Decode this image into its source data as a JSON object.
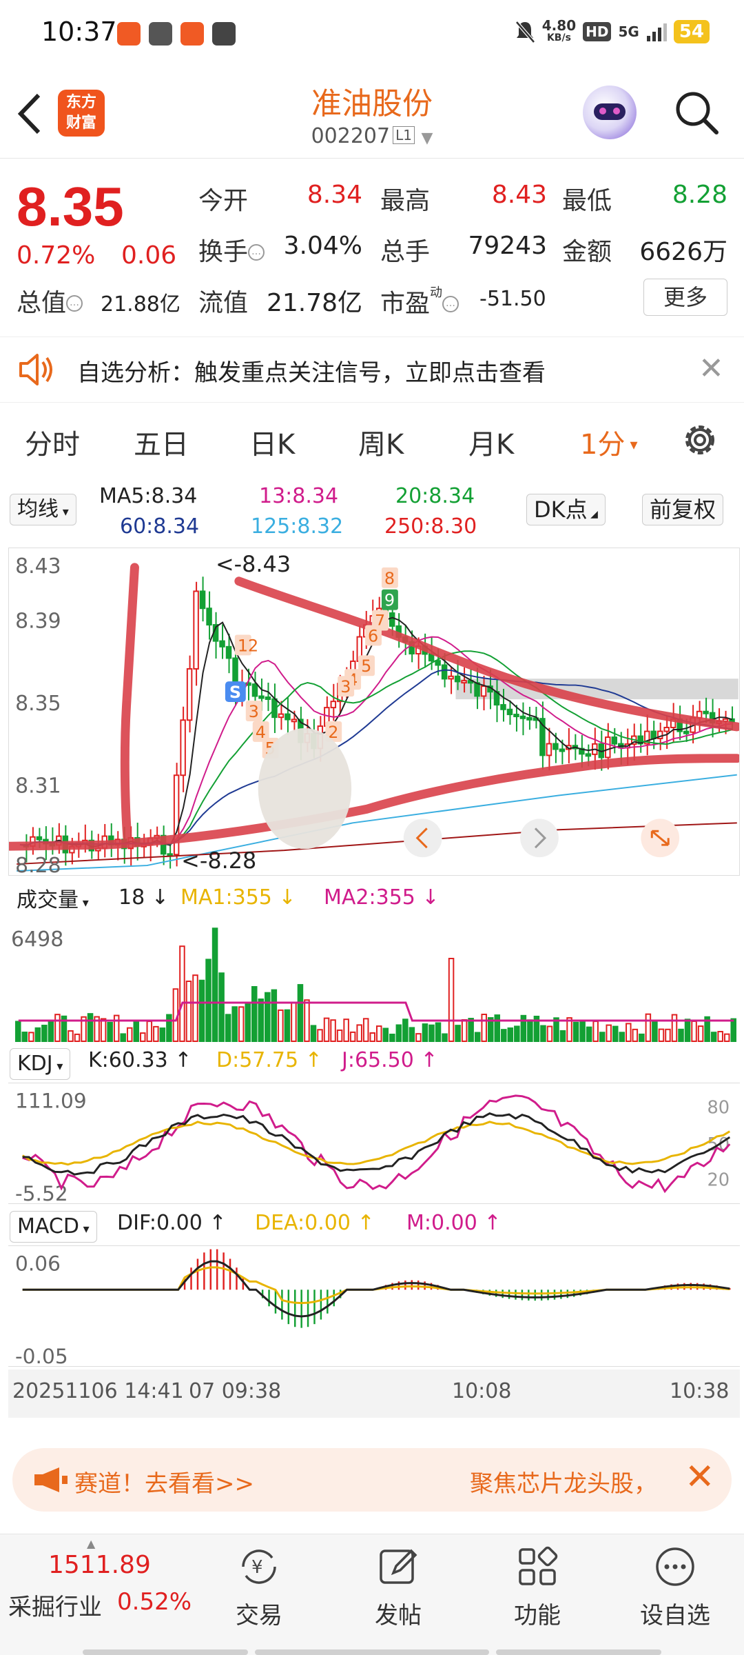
{
  "status_bar": {
    "time": "10:37",
    "net_speed": "4.80",
    "net_unit": "KB/s",
    "hd": "HD",
    "signal": "5G",
    "battery": "54"
  },
  "header": {
    "logo_line1": "东方",
    "logo_line2": "财富",
    "stock_name": "准油股份",
    "stock_code": "002207",
    "level_badge": "L1"
  },
  "quote": {
    "price": "8.35",
    "change_pct": "0.72%",
    "change": "0.06",
    "open_label": "今开",
    "open": "8.34",
    "high_label": "最高",
    "high": "8.43",
    "low_label": "最低",
    "low": "8.28",
    "turnover_label": "换手",
    "turnover": "3.04%",
    "volume_label": "总手",
    "volume": "79243",
    "amount_label": "金额",
    "amount": "6626万",
    "mktcap_label": "总值",
    "mktcap": "21.88亿",
    "float_label": "流值",
    "float_cap": "21.78亿",
    "pe_label": "市盈",
    "pe_sup": "动",
    "pe": "-51.50",
    "more_label": "更多"
  },
  "notice": {
    "text": "自选分析：触发重点关注信号，立即点击查看"
  },
  "tabs": [
    "分时",
    "五日",
    "日K",
    "周K",
    "月K",
    "1分"
  ],
  "chart": {
    "ma_selector": "均线",
    "ma5": "MA5:8.34",
    "ma13": "13:8.34",
    "ma20": "20:8.34",
    "ma60": "60:8.34",
    "ma125": "125:8.32",
    "ma250": "250:8.30",
    "dk_button": "DK点",
    "adjust_button": "前复权",
    "price_ticks": [
      "8.43",
      "8.39",
      "8.35",
      "8.31",
      "8.28"
    ],
    "high_marker": "<-8.43",
    "low_marker": "<-8.28",
    "td_labels": [
      "8",
      "9",
      "7",
      "6",
      "5",
      "4",
      "3",
      "12",
      "3",
      "4",
      "5",
      "2"
    ],
    "signal_s": "S",
    "vol_selector": "成交量",
    "vol_value": "18",
    "vol_ma1": "MA1:355",
    "vol_ma2": "MA2:355",
    "vol_tick": "6498",
    "kdj_selector": "KDJ",
    "kdj_k": "K:60.33",
    "kdj_d": "D:57.75",
    "kdj_j": "J:65.50",
    "kdj_ticks": [
      "111.09",
      "-5.52"
    ],
    "kdj_levels": [
      "80",
      "50",
      "20"
    ],
    "macd_selector": "MACD",
    "macd_dif": "DIF:0.00",
    "macd_dea": "DEA:0.00",
    "macd_m": "M:0.00",
    "macd_ticks": [
      "0.06",
      "-0.05"
    ],
    "time_axis": [
      "20251106 14:41",
      "07 09:38",
      "10:08",
      "10:38"
    ],
    "colors": {
      "up": "#e02020",
      "down": "#13a034",
      "ma5": "#222222",
      "ma13": "#d01c8b",
      "ma20": "#13a034",
      "ma60": "#1f3a93",
      "ma125": "#3aaee0",
      "ma250": "#a01616"
    }
  },
  "ad": {
    "left": "赛道！去看看>>",
    "right": "聚焦芯片龙头股，"
  },
  "bottom_nav": {
    "index_value": "1511.89",
    "index_name": "采掘行业",
    "index_change": "0.52%",
    "items": [
      "交易",
      "发帖",
      "功能",
      "设自选"
    ]
  }
}
